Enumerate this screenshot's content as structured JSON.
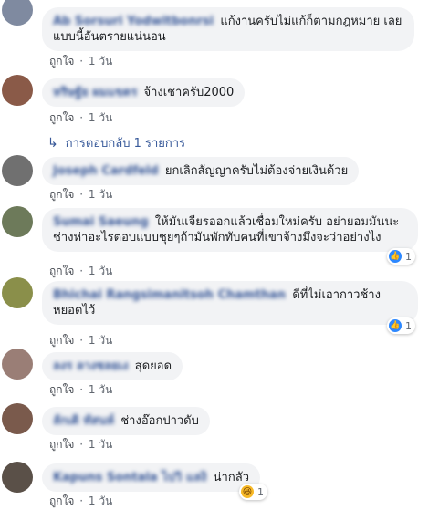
{
  "comments": [
    {
      "author": "Ab Sorsuri Yodwitbonrsi",
      "text": "แก้งานครับไม่แก้ก็ตามกฎหมาย เลยแบบนี้อันตรายแน่นอน",
      "like_label": "ถูกใจ",
      "time": "1 วัน",
      "avatar_color": "#7f8aa0"
    },
    {
      "author": "หริษฐัย ผมแขตร",
      "text": "จ้างเชาครับ2000",
      "like_label": "ถูกใจ",
      "time": "1 วัน",
      "avatar_color": "#8a5a48"
    },
    {
      "author": "Joseph Cardfeld",
      "text": "ยกเลิกสัญญาครับไม่ต้องจ่ายเงินด้วย",
      "like_label": "ถูกใจ",
      "time": "1 วัน",
      "avatar_color": "#707070"
    },
    {
      "author": "Sumai Saeung",
      "text": "ให้มันเจียรออกแล้วเชื่อมใหม่ครับ อย่ายอมมันนะ ช่างห่าอะไรตอบแบบชุยๆถ้ามันพักทับคนที่เขาจ้างมึงจะว่าอย่างไง",
      "like_label": "ถูกใจ",
      "time": "1 วัน",
      "avatar_color": "#6d7a5a",
      "reaction": {
        "icon": "like-icon",
        "count": "1"
      }
    },
    {
      "author": "Bhichai Rangsimanitsoh Chamthan",
      "text": "ดีที่ไม่เอากาวช้าง หยอดไว้",
      "like_label": "ถูกใจ",
      "time": "1 วัน",
      "avatar_color": "#8a8f4a",
      "reaction": {
        "icon": "like-icon",
        "count": "1"
      }
    },
    {
      "author": "ลงร ลางชลยเง",
      "text": "สุดยอด",
      "like_label": "ถูกใจ",
      "time": "1 วัน",
      "avatar_color": "#9a7e76"
    },
    {
      "author": "ลักเดิ ทัสนห์",
      "text": "ช่างอ๊อกปาวดับ",
      "like_label": "ถูกใจ",
      "time": "1 วัน",
      "avatar_color": "#7a5a4c"
    },
    {
      "author": "Kapuns Sontala ไปวิ แลงิ",
      "text": "น่ากลัว",
      "like_label": "ถูกใจ",
      "time": "1 วัน",
      "avatar_color": "#5a5048",
      "reaction": {
        "icon": "haha-icon",
        "count": "1"
      }
    }
  ],
  "replies_link": "การตอบกลับ 1 รายการ"
}
